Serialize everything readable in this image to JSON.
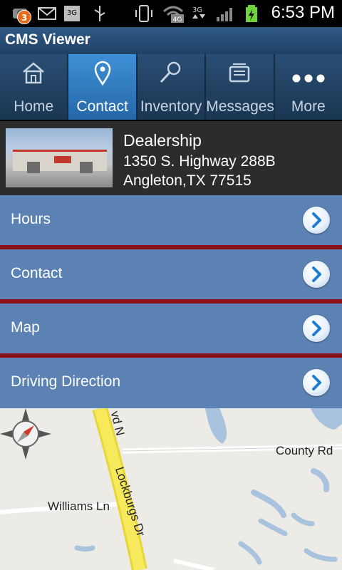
{
  "status_bar": {
    "notification_count": "3",
    "time": "6:53 PM",
    "icons": [
      "notification-icon",
      "email-icon",
      "3g-icon",
      "usb-icon",
      "vibrate-icon",
      "4g-wifi-icon",
      "3g-data-icon",
      "signal-icon",
      "battery-icon"
    ]
  },
  "app": {
    "title": "CMS Viewer"
  },
  "tabs": [
    {
      "label": "Home",
      "icon": "home-icon",
      "active": false
    },
    {
      "label": "Contact",
      "icon": "location-pin-icon",
      "active": true
    },
    {
      "label": "Inventory",
      "icon": "search-icon",
      "active": false
    },
    {
      "label": "Messages",
      "icon": "inbox-icon",
      "active": false
    },
    {
      "label": "More",
      "icon": "more-icon",
      "active": false
    }
  ],
  "dealer": {
    "name": "Dealership",
    "address_line1": "1350 S. Highway 288B",
    "address_line2": "Angleton,TX 77515"
  },
  "menu": [
    {
      "label": "Hours"
    },
    {
      "label": "Contact"
    },
    {
      "label": "Map"
    },
    {
      "label": "Driving Direction"
    }
  ],
  "map": {
    "labels": {
      "road_vertical_top": "vd N",
      "road_county": "County Rd",
      "road_lockburgs": "Lockburgs Dr",
      "road_williams": "Williams Ln"
    }
  },
  "colors": {
    "title_bar": "#2f5a86",
    "tab_active": "#3f8fd6",
    "menu_row": "#5c82b4",
    "separator": "#8c0f18"
  }
}
